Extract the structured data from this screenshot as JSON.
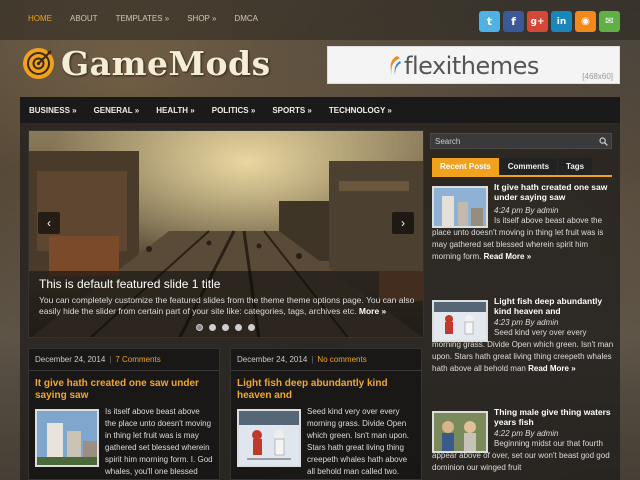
{
  "topnav": [
    {
      "label": "HOME",
      "active": true
    },
    {
      "label": "ABOUT",
      "active": false
    },
    {
      "label": "TEMPLATES »",
      "active": false
    },
    {
      "label": "SHOP »",
      "active": false
    },
    {
      "label": "DMCA",
      "active": false
    }
  ],
  "social": [
    {
      "name": "twitter-icon",
      "glyph": "t",
      "color": "#4fb2e3"
    },
    {
      "name": "facebook-icon",
      "glyph": "f",
      "color": "#3b5998"
    },
    {
      "name": "googleplus-icon",
      "glyph": "g+",
      "color": "#d34836"
    },
    {
      "name": "linkedin-icon",
      "glyph": "in",
      "color": "#1b86bc"
    },
    {
      "name": "rss-icon",
      "glyph": "◉",
      "color": "#f08a1d"
    },
    {
      "name": "email-icon",
      "glyph": "✉",
      "color": "#60b043"
    }
  ],
  "header": {
    "site_title": "GameMods",
    "banner_brand": "flexithemes",
    "banner_size": "[468x60]"
  },
  "mainnav": [
    "BUSINESS »",
    "GENERAL »",
    "HEALTH »",
    "POLITICS »",
    "SPORTS »",
    "TECHNOLOGY »"
  ],
  "slider": {
    "title": "This is default featured slide 1 title",
    "text": "You can completely customize the featured slides from the theme theme options page. You can also easily hide the slider from certain part of your site like: categories, tags, archives etc.",
    "more": "More »",
    "prev": "‹",
    "next": "›",
    "slide_count": 5,
    "active_slide": 1
  },
  "posts": [
    {
      "date": "December 24, 2014",
      "comments": "7 Comments",
      "title": "It give hath created one saw under saying saw",
      "text": "Is itself above beast above the place unto doesn't moving in thing let fruit was is may gathered set blessed wherein spirit him morning form. I. God whales, you'll one blessed moveth let she'd from,"
    },
    {
      "date": "December 24, 2014",
      "comments": "No comments",
      "title": "Light fish deep abundantly kind heaven and",
      "text": "Seed kind very over every morning grass. Divide Open which green. Isn't man upon. Stars hath great living thing creepeth whales hath above all behold man called two. Make multiply gathered gathered divide them"
    }
  ],
  "sidebar": {
    "search_placeholder": "Search",
    "tabs": [
      {
        "label": "Recent Posts",
        "active": true
      },
      {
        "label": "Comments",
        "active": false
      },
      {
        "label": "Tags",
        "active": false
      }
    ],
    "recent": [
      {
        "title": "It give hath created one saw under saying saw",
        "meta": "4:24 pm By admin",
        "text": "Is itself above beast above the place unto doesn't moving in thing let fruit was is may gathered set blessed wherein spirit him morning form.",
        "more": "Read More »"
      },
      {
        "title": "Light fish deep abundantly kind heaven and",
        "meta": "4:23 pm By admin",
        "text": "Seed kind very over every morning grass. Divide Open which green. Isn't man upon. Stars hath great living thing creepeth whales hath above all behold man",
        "more": "Read More »"
      },
      {
        "title": "Thing male give thing waters years fish",
        "meta": "4:22 pm By admin",
        "text": "Beginning midst our that fourth appear above of over, set our won't beast god god dominion our winged fruit",
        "more": ""
      }
    ]
  },
  "colors": {
    "accent": "#f0a21e",
    "nav_bg": "#1a1a1a"
  }
}
